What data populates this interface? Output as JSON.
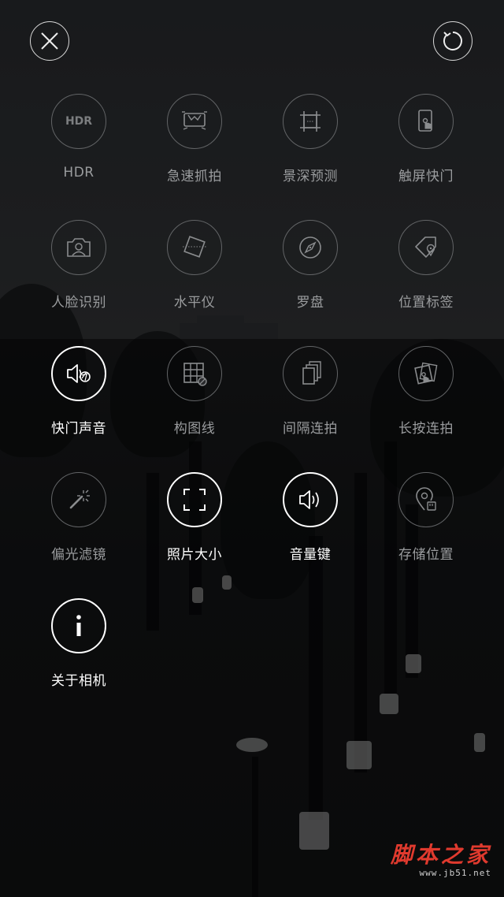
{
  "top_bar": {
    "close_icon": "close-icon",
    "reset_icon": "reset-icon"
  },
  "settings": [
    {
      "id": "hdr",
      "label": "HDR",
      "icon": "hdr-icon",
      "icon_text": "HDR",
      "active": false
    },
    {
      "id": "rapid-capture",
      "label": "急速抓拍",
      "icon": "rapid-capture-icon",
      "active": false
    },
    {
      "id": "depth-preview",
      "label": "景深预测",
      "icon": "depth-preview-icon",
      "active": false
    },
    {
      "id": "touch-shutter",
      "label": "触屏快门",
      "icon": "touch-shutter-icon",
      "active": false
    },
    {
      "id": "face-recognition",
      "label": "人脸识别",
      "icon": "face-recognition-icon",
      "active": false
    },
    {
      "id": "level",
      "label": "水平仪",
      "icon": "level-icon",
      "active": false
    },
    {
      "id": "compass",
      "label": "罗盘",
      "icon": "compass-icon",
      "active": false
    },
    {
      "id": "location-tag",
      "label": "位置标签",
      "icon": "location-tag-icon",
      "active": false
    },
    {
      "id": "shutter-sound",
      "label": "快门声音",
      "icon": "shutter-sound-icon",
      "active": true
    },
    {
      "id": "grid-lines",
      "label": "构图线",
      "icon": "grid-lines-icon",
      "active": false
    },
    {
      "id": "interval-burst",
      "label": "间隔连拍",
      "icon": "interval-burst-icon",
      "active": false
    },
    {
      "id": "long-press-burst",
      "label": "长按连拍",
      "icon": "long-press-burst-icon",
      "active": false
    },
    {
      "id": "polarizer",
      "label": "偏光滤镜",
      "icon": "magic-wand-icon",
      "active": false
    },
    {
      "id": "photo-size",
      "label": "照片大小",
      "icon": "photo-size-icon",
      "active": true
    },
    {
      "id": "volume-key",
      "label": "音量键",
      "icon": "volume-key-icon",
      "active": true
    },
    {
      "id": "storage-location",
      "label": "存储位置",
      "icon": "storage-location-icon",
      "active": false
    },
    {
      "id": "about-camera",
      "label": "关于相机",
      "icon": "info-icon",
      "active": true
    }
  ],
  "watermark": {
    "text": "脚本之家",
    "url": "www.jb51.net"
  },
  "colors": {
    "active": "#ffffff",
    "inactive": "#9a9c9e",
    "inactive_border": "#626466",
    "watermark": "#e03a2e"
  }
}
